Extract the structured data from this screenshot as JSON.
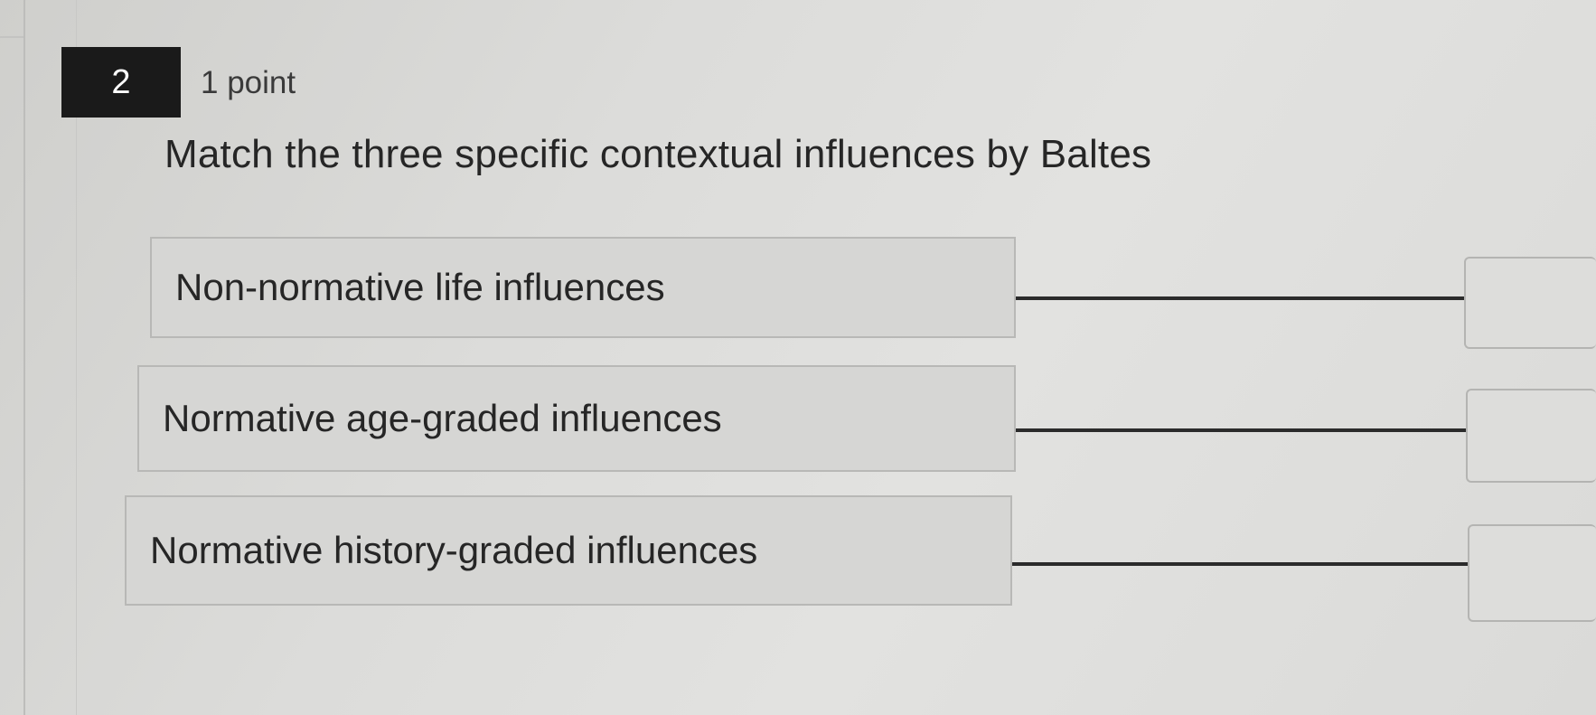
{
  "question": {
    "number": "2",
    "points": "1 point",
    "prompt": "Match the three specific contextual influences by Baltes"
  },
  "items": [
    {
      "label": "Non-normative life influences",
      "answer": ""
    },
    {
      "label": "Normative age-graded influences",
      "answer": ""
    },
    {
      "label": "Normative history-graded influences",
      "answer": ""
    }
  ]
}
